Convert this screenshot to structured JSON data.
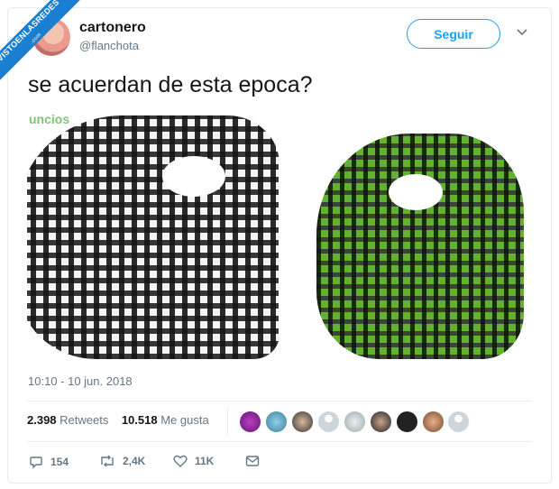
{
  "watermark": {
    "main": "VISTOENLASREDES",
    "sub": ".com"
  },
  "user": {
    "name": "cartonero",
    "handle": "@flanchota"
  },
  "follow_label": "Seguir",
  "tweet_text": "se acuerdan de esta epoca?",
  "media_watermark": "uncios",
  "timestamp": "10:10 - 10 jun. 2018",
  "stats": {
    "retweets_count": "2.398",
    "retweets_label": "Retweets",
    "likes_count": "10.518",
    "likes_label": "Me gusta"
  },
  "actions": {
    "replies": "154",
    "retweets": "2,4K",
    "likes": "11K"
  },
  "colors": {
    "accent": "#1da1f2",
    "watermark_blue": "#1a7fd0",
    "muted": "#657786"
  }
}
